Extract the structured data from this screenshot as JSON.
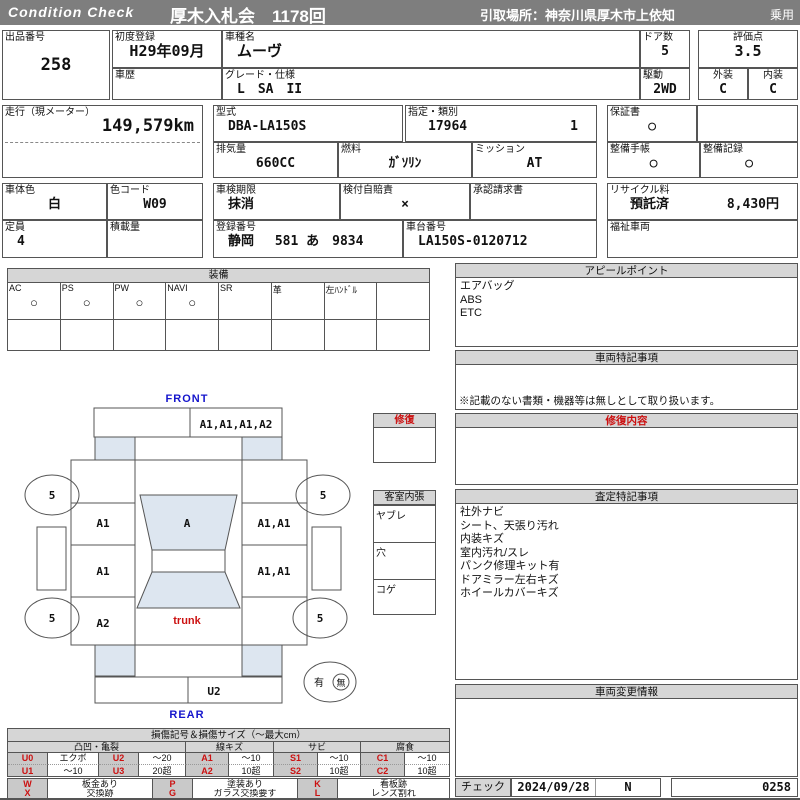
{
  "colors": {
    "bar-gray": "#7e7e7e",
    "head-gray": "#d6d6d6",
    "code-gray": "#c9c9c9",
    "accent-red": "#cc1111",
    "accent-blue": "#1515cc",
    "shade-blue": "#dde6f0",
    "border-dark": "#333333"
  },
  "header": {
    "logo": "Condition  Check",
    "title": "厚木入札会　1178回",
    "pickup": "引取場所：神奈川県厚木市上依知",
    "usage": "乗用"
  },
  "info": {
    "lot_label": "出品番号",
    "lot": "258",
    "first_reg_label": "初度登録",
    "first_reg": "H29年09月",
    "history_label": "車歴",
    "history": "",
    "model_name_label": "車種名",
    "model_name": "ムーヴ",
    "grade_label": "グレード・仕様",
    "grade": "L　SA　II",
    "doors_label": "ドア数",
    "doors": "5",
    "drive_label": "駆動",
    "drive": "2WD",
    "score_label": "評価点",
    "score": "3.5",
    "exterior_label": "外装",
    "exterior": "C",
    "interior_label": "内装",
    "interior": "C",
    "mileage_label": "走行（現メーター）",
    "mileage": "149,579km",
    "model_code_label": "型式",
    "model_code": "DBA-LA150S",
    "class_label": "指定・類別",
    "class_no": "17964",
    "class_sub": "1",
    "warranty_label": "保証書",
    "warranty": "○",
    "displacement_label": "排気量",
    "displacement": "660CC",
    "fuel_label": "燃料",
    "fuel": "ｶﾞｿﾘﾝ",
    "mission_label": "ミッション",
    "mission": "AT",
    "maintenance_book_label": "整備手帳",
    "maintenance_book": "○",
    "maintenance_record_label": "整備記録",
    "maintenance_record": "○",
    "color_label": "車体色",
    "color": "白",
    "color_code_label": "色コード",
    "color_code": "W09",
    "inspection_label": "車検期限",
    "inspection": "抹消",
    "insurance_label": "検付自賠責",
    "insurance": "×",
    "approval_label": "承認請求書",
    "approval": "",
    "recycle_label": "リサイクル料",
    "recycle_status": "預託済",
    "recycle_fee": "8,430円",
    "capacity_label": "定員",
    "capacity": "4",
    "load_label": "積載量",
    "load": "",
    "reg_no_label": "登録番号",
    "reg_no": "静岡　 581 あ　9834",
    "chassis_label": "車台番号",
    "chassis_no": "LA150S-0120712",
    "welfare_label": "福祉車両",
    "welfare": ""
  },
  "equipment": {
    "title": "装備",
    "items": [
      {
        "label": "AC",
        "value": "○"
      },
      {
        "label": "PS",
        "value": "○"
      },
      {
        "label": "PW",
        "value": "○"
      },
      {
        "label": "NAVI",
        "value": "○"
      },
      {
        "label": "SR",
        "value": ""
      },
      {
        "label": "革",
        "value": ""
      },
      {
        "label": "左ﾊﾝﾄﾞﾙ",
        "value": ""
      },
      {
        "label": "",
        "value": ""
      }
    ]
  },
  "panels": {
    "appeal": {
      "title": "アピールポイント",
      "lines": [
        "エアバッグ",
        "ABS",
        "ETC"
      ]
    },
    "vehicle_notes": {
      "title": "車両特記事項",
      "note": "※記載のない書類・機器等は無しとして取り扱います。"
    },
    "repair_details": {
      "title": "修復内容",
      "lines": []
    },
    "assessment": {
      "title": "査定特記事項",
      "lines": [
        "社外ナビ",
        "シート、天張り汚れ",
        "内装キズ",
        "室内汚れ/スレ",
        "パンク修理キット有",
        "ドアミラー左右キズ",
        "ホイールカバーキズ"
      ]
    },
    "change_info": {
      "title": "車両変更情報",
      "lines": []
    }
  },
  "diagram": {
    "front": "FRONT",
    "rear": "REAR",
    "hood": "A1,A1,A1,A2",
    "windshield": "A",
    "left_fender": "A1",
    "left_door": "A1",
    "left_quarter": "A2",
    "right_fender": "A1,A1",
    "right_door": "A1,A1",
    "trunk": "trunk",
    "rear_panel": "U2",
    "tire_fl": "5",
    "tire_fr": "5",
    "tire_rl": "5",
    "tire_rr": "5",
    "spare_yes": "有",
    "spare_no": "無",
    "repair": {
      "title": "修復"
    },
    "cabin": {
      "title": "客室内張",
      "rows": [
        "ヤブレ",
        "穴",
        "コゲ"
      ]
    }
  },
  "legend": {
    "title": "損傷記号＆損傷サイズ（～最大cm）",
    "sections": [
      "凸凹・亀裂",
      "線キズ",
      "サビ",
      "腐食"
    ],
    "row1": [
      "U0",
      "エクボ",
      "U2",
      "～20",
      "A1",
      "～10",
      "S1",
      "～10",
      "C1",
      "～10"
    ],
    "row2": [
      "U1",
      "～10",
      "U3",
      "20超",
      "A2",
      "10超",
      "S2",
      "10超",
      "C2",
      "10超"
    ],
    "row3": [
      "W",
      "板金あり",
      "P",
      "塗装あり",
      "K",
      "看板跡"
    ],
    "row4": [
      "X",
      "交換跡",
      "G",
      "ガラス交換要す",
      "L",
      "レンズ割れ"
    ]
  },
  "check": {
    "label": "チェック",
    "date": "2024/09/28",
    "flag": "N",
    "number": "0258"
  }
}
